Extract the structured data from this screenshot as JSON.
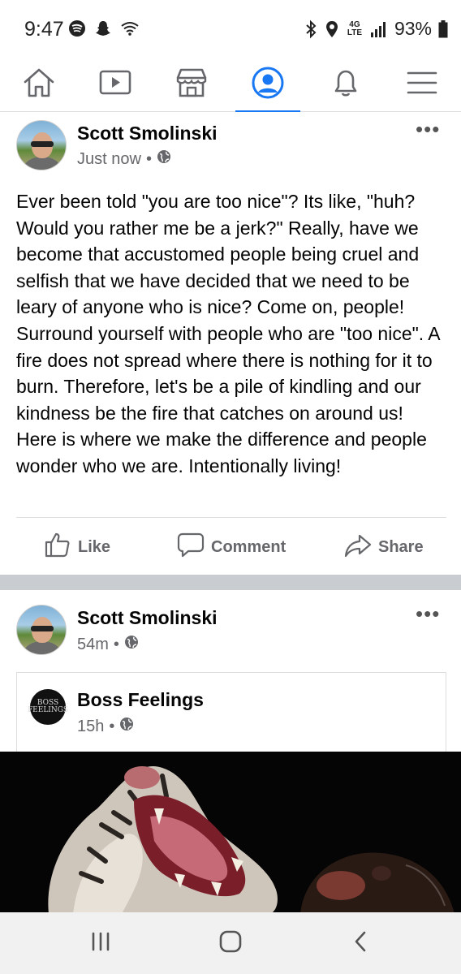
{
  "status_bar": {
    "time": "9:47",
    "battery": "93%",
    "network": "4G LTE",
    "icons": [
      "spotify-icon",
      "snapchat-icon",
      "wifi-icon",
      "bluetooth-icon",
      "location-icon",
      "signal-icon",
      "battery-icon"
    ]
  },
  "navbar": {
    "items": [
      "home-icon",
      "watch-icon",
      "marketplace-icon",
      "profile-icon",
      "notifications-icon",
      "menu-icon"
    ],
    "active": "profile-icon",
    "accent": "#1877f2"
  },
  "post1": {
    "author": "Scott Smolinski",
    "time": "Just now",
    "separator": "•",
    "text": "Ever been told \"you are too nice\"? Its like, \"huh? Would you rather me be a jerk?\" Really, have we become that accustomed people being cruel and selfish that we have decided that we need to be leary of anyone who is nice? Come on, people! Surround yourself with people who are \"too nice\". A fire does not spread where there is nothing for it to burn. Therefore, let's be a pile of kindling and our kindness be the fire that catches on around us! Here is where we make the difference and people wonder who we are. Intentionally living!",
    "actions": {
      "like": "Like",
      "comment": "Comment",
      "share": "Share"
    }
  },
  "post2": {
    "author": "Scott Smolinski",
    "time": "54m",
    "separator": "•",
    "shared": {
      "page_name": "Boss Feelings",
      "time": "15h",
      "logo_text": "BOSS FEELINGS"
    }
  },
  "android_nav": {
    "buttons": [
      "recents-icon",
      "home-button-icon",
      "back-icon"
    ]
  }
}
